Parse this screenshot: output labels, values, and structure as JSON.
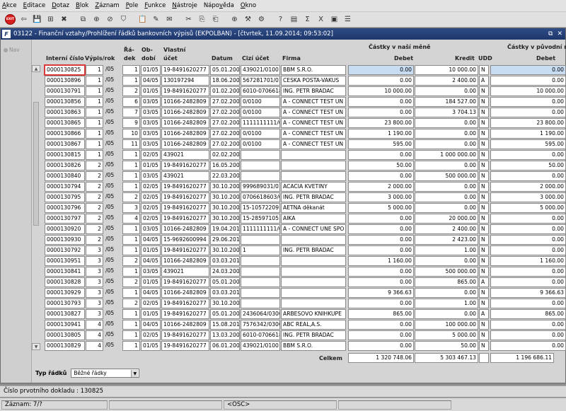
{
  "menu": [
    "Akce",
    "Editace",
    "Dotaz",
    "Blok",
    "Záznam",
    "Pole",
    "Funkce",
    "Nástroje",
    "Nápověda",
    "Okno"
  ],
  "menu_underline": [
    "A",
    "E",
    "D",
    "B",
    "Z",
    "P",
    "F",
    "N",
    "v",
    "O"
  ],
  "toolbar": {
    "exit_label": "EXIT",
    "icons": [
      "exit-icon",
      "back-icon",
      "save-icon",
      "new-record-icon",
      "delete-icon",
      "sep",
      "copy-record-icon",
      "insert-icon",
      "clear-icon",
      "filter-icon",
      "sep",
      "paste-icon",
      "edit-icon",
      "mail-icon",
      "sep",
      "cut-icon",
      "copy-icon",
      "paste2-icon",
      "sep",
      "graph-icon",
      "tools-icon",
      "settings-icon",
      "sep",
      "help-icon",
      "doc-icon",
      "sum-icon",
      "excel-icon",
      "image-icon",
      "options-icon"
    ]
  },
  "window": {
    "title": "03122 - Finanční vztahy/Prohlížení řádků bankovních výpisů (EKPOLBAN) - [čtvrtek, 11.09.2014; 09:53:02]",
    "logo": "F",
    "controls": [
      "⧉",
      "✕"
    ]
  },
  "nav_label": "Nav",
  "headers": {
    "group1": "Částky v naší měně",
    "group2": "Částky v původní m",
    "interni_cislo": "Interní číslo",
    "vypis_rok": "Výpis/rok",
    "radek": "Řá-\ndek",
    "obdobi": "Ob-\ndobí",
    "vlastni_ucet": "Vlastní\núčet",
    "datum": "Datum",
    "cizi_ucet": "Cizí účet",
    "firma": "Firma",
    "debet": "Debet",
    "kredit": "Kredit",
    "udd": "UDD",
    "debet2": "Debet"
  },
  "rows": [
    [
      "0000130825",
      "1",
      "/05",
      "1",
      "01/05",
      "19-8491620277",
      "05.01.2005",
      "439021/0100",
      "BBM S.R.O.",
      "0.00",
      "10 000.00",
      "N",
      "0.00"
    ],
    [
      "0000130896",
      "1",
      "/05",
      "1",
      "04/05",
      "130197294",
      "18.06.2009",
      "567281701/01",
      "CESKA POSTA-VAKUS",
      "0.00",
      "2 400.00",
      "A",
      "0.00"
    ],
    [
      "0000130791",
      "1",
      "/05",
      "2",
      "01/05",
      "19-8491620277",
      "01.02.2005",
      "6010-0706618",
      "ING. PETR BRADAC",
      "10 000.00",
      "0.00",
      "N",
      "10 000.00"
    ],
    [
      "0000130856",
      "1",
      "/05",
      "6",
      "03/05",
      "10166-2482809",
      "27.02.2008",
      "0/0100",
      "A - CONNECT TEST UN",
      "0.00",
      "184 527.00",
      "N",
      "0.00"
    ],
    [
      "0000130863",
      "1",
      "/05",
      "7",
      "03/05",
      "10166-2482809",
      "27.02.2008",
      "0/0100",
      "A - CONNECT TEST UN",
      "0.00",
      "3 704.13",
      "N",
      "0.00"
    ],
    [
      "0000130865",
      "1",
      "/05",
      "9",
      "03/05",
      "10166-2482809",
      "27.02.2008",
      "1111111111/0",
      "A - CONNECT TEST UN",
      "23 800.00",
      "0.00",
      "N",
      "23 800.00"
    ],
    [
      "0000130866",
      "1",
      "/05",
      "10",
      "03/05",
      "10166-2482809",
      "27.02.2008",
      "0/0100",
      "A - CONNECT TEST UN",
      "1 190.00",
      "0.00",
      "N",
      "1 190.00"
    ],
    [
      "0000130867",
      "1",
      "/05",
      "11",
      "03/05",
      "10166-2482809",
      "27.02.2008",
      "0/0100",
      "A - CONNECT TEST UN",
      "595.00",
      "0.00",
      "N",
      "595.00"
    ],
    [
      "0000130815",
      "1",
      "/05",
      "1",
      "02/05",
      "439021",
      "02.02.2005",
      "",
      "",
      "0.00",
      "1 000 000.00",
      "N",
      "0.00"
    ],
    [
      "0000130826",
      "2",
      "/05",
      "1",
      "01/05",
      "19-8491620277",
      "16.05.2007",
      "",
      "",
      "50.00",
      "0.00",
      "N",
      "50.00"
    ],
    [
      "0000130840",
      "2",
      "/05",
      "1",
      "03/05",
      "439021",
      "22.03.2005",
      "",
      "",
      "0.00",
      "500 000.00",
      "N",
      "0.00"
    ],
    [
      "0000130794",
      "2",
      "/05",
      "1",
      "02/05",
      "19-8491620277",
      "30.10.2005",
      "999689031/01",
      "ACACIA KVETINY",
      "2 000.00",
      "0.00",
      "N",
      "2 000.00"
    ],
    [
      "0000130795",
      "2",
      "/05",
      "2",
      "02/05",
      "19-8491620277",
      "30.10.2005",
      "0706618603/0",
      "ING. PETR BRADAC",
      "3 000.00",
      "0.00",
      "N",
      "3 000.00"
    ],
    [
      "0000130796",
      "2",
      "/05",
      "3",
      "02/05",
      "19-8491620277",
      "30.10.2005",
      "15-10572209",
      "AETNA děkanát",
      "5 000.00",
      "0.00",
      "N",
      "5 000.00"
    ],
    [
      "0000130797",
      "2",
      "/05",
      "4",
      "02/05",
      "19-8491620277",
      "30.10.2005",
      "15-28597105",
      "AIKA",
      "0.00",
      "20 000.00",
      "N",
      "0.00"
    ],
    [
      "0000130920",
      "2",
      "/05",
      "1",
      "03/05",
      "10166-2482809",
      "19.04.2010",
      "1111111111/0",
      "A - CONNECT UNE SPO",
      "0.00",
      "2 400.00",
      "N",
      "0.00"
    ],
    [
      "0000130930",
      "2",
      "/05",
      "1",
      "04/05",
      "15-9692600994",
      "29.06.2011",
      "",
      "",
      "0.00",
      "2 423.00",
      "N",
      "0.00"
    ],
    [
      "0000130792",
      "3",
      "/05",
      "1",
      "01/05",
      "19-8491620277",
      "30.10.2005",
      "1",
      "ING. PETR BRADAC",
      "0.00",
      "1.00",
      "N",
      "0.00"
    ],
    [
      "0000130951",
      "3",
      "/05",
      "2",
      "04/05",
      "10166-2482809",
      "03.03.2011",
      "",
      "",
      "1 160.00",
      "0.00",
      "N",
      "1 160.00"
    ],
    [
      "0000130841",
      "3",
      "/05",
      "1",
      "03/05",
      "439021",
      "24.03.2005",
      "",
      "",
      "0.00",
      "500 000.00",
      "N",
      "0.00"
    ],
    [
      "0000130828",
      "3",
      "/05",
      "2",
      "01/05",
      "19-8491620277",
      "05.01.2005",
      "",
      "",
      "0.00",
      "865.00",
      "A",
      "0.00"
    ],
    [
      "0000130929",
      "3",
      "/05",
      "1",
      "04/05",
      "10166-2482809",
      "03.03.2011",
      "",
      "",
      "9 366.63",
      "0.00",
      "N",
      "9 366.63"
    ],
    [
      "0000130793",
      "3",
      "/05",
      "2",
      "02/05",
      "19-8491620277",
      "30.10.2005",
      "",
      "",
      "0.00",
      "1.00",
      "N",
      "0.00"
    ],
    [
      "0000130827",
      "3",
      "/05",
      "1",
      "01/05",
      "19-8491620277",
      "05.01.2005",
      "2436064/0300",
      "ARBESOVO KNIHKUPE",
      "865.00",
      "0.00",
      "A",
      "865.00"
    ],
    [
      "0000130941",
      "4",
      "/05",
      "1",
      "04/05",
      "10166-2482809",
      "15.08.2012",
      "7576342/0300",
      "ABC REAL,A.S.",
      "0.00",
      "100 000.00",
      "N",
      "0.00"
    ],
    [
      "0000130805",
      "4",
      "/05",
      "1",
      "02/05",
      "19-8491620277",
      "13.03.2006",
      "6010-0706618",
      "ING. PETR BRADAC",
      "0.00",
      "5 000.00",
      "N",
      "0.00"
    ],
    [
      "0000130829",
      "4",
      "/05",
      "1",
      "01/05",
      "19-8491620277",
      "06.01.2005",
      "439021/0100",
      "BBM S.R.O.",
      "0.00",
      "50.00",
      "N",
      "0.00"
    ]
  ],
  "totals": {
    "label": "Celkem",
    "debet": "1 320 748.06",
    "kredit": "5 303 467.13",
    "debet2": "1 196 686.11"
  },
  "typ_radku": {
    "label": "Typ řádků",
    "value": "Běžné řádky"
  },
  "status": {
    "line1": "Číslo prvotního dokladu : 130825",
    "zaznam": "Záznam: 7/?",
    "mode": "<OSC>"
  }
}
